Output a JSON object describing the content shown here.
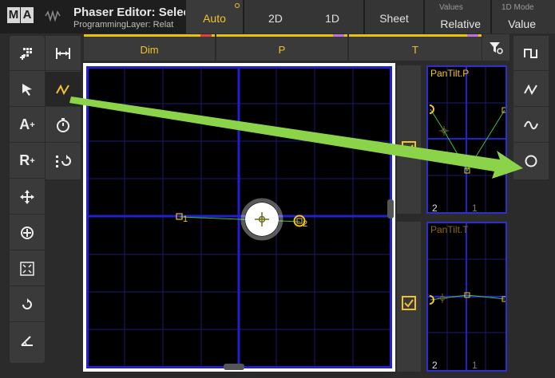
{
  "header": {
    "logo_left": "M",
    "logo_right": "A",
    "title": "Phaser Editor: Select",
    "subtitle": "ProgrammingLayer: Relat",
    "auto_label": "Auto",
    "view_2d": "2D",
    "view_1d": "1D",
    "sheet": "Sheet",
    "values_caption": "Values",
    "values_value": "Relative",
    "mode_caption": "1D Mode",
    "mode_value": "Value"
  },
  "tabs": [
    {
      "label": "Dim"
    },
    {
      "label": "P"
    },
    {
      "label": "T"
    }
  ],
  "left_toolbar": {
    "add_step_icon": "add-step-icon",
    "select_icon": "cursor-icon",
    "add_attribute_label": "A",
    "add_relative_label": "R",
    "move_icon": "move-icon",
    "center_icon": "center-icon",
    "scale_icon": "scale-icon",
    "rotate_icon": "rotate-icon",
    "angle_icon": "angle-icon",
    "width_icon": "width-icon",
    "draw_icon": "draw-icon",
    "timer_icon": "timer-icon",
    "phase_icon": "phase-icon"
  },
  "right_toolbar": [
    "square-wave-icon",
    "zigzag-icon",
    "sine-icon",
    "circle-icon"
  ],
  "grid": {
    "point_labels": [
      "1",
      "2"
    ]
  },
  "mini_panels": [
    {
      "title": "PanTilt.P",
      "x_label_left": "2",
      "x_label_right": "1",
      "title_color": "#f2c22e",
      "checked": true
    },
    {
      "title": "PanTilt.T",
      "x_label_left": "2",
      "x_label_right": "1",
      "title_color": "#8a6a10",
      "checked": true
    }
  ],
  "colors": {
    "accent": "#f2c22e",
    "grid_blue": "#2020d0",
    "curve_green": "#40c040",
    "arrow_green": "#8bd44a"
  }
}
